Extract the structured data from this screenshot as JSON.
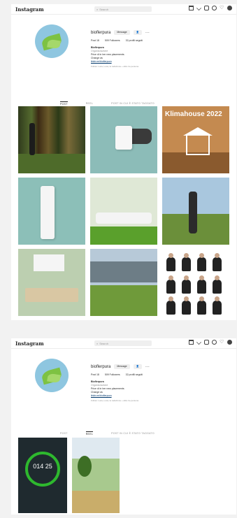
{
  "topbar": {
    "logo": "Instagram",
    "search_placeholder": "Search"
  },
  "profile": {
    "username": "bioflerpura",
    "message_button": "Message",
    "stats": {
      "posts": "Post 18",
      "followers": "509 Followers",
      "following": "32 profili seguiti"
    },
    "bio": {
      "name": "Bioflerpura",
      "category": "Organizzazione",
      "line1": "Price di in her new placements",
      "line2": "Change as",
      "link": "linktr.ee/bioflerpura"
    },
    "followed_by": "Follow: Luca, Luca, la redazione + altre tre persone"
  },
  "tabs": {
    "posts": "POST",
    "reels": "REEL",
    "tagged": "POST IN CUI È STATO TAGGATO"
  },
  "grid": {
    "klimahouse_text": "Klimahouse 2022"
  },
  "screenshot2": {
    "device_reading": "014 25"
  }
}
